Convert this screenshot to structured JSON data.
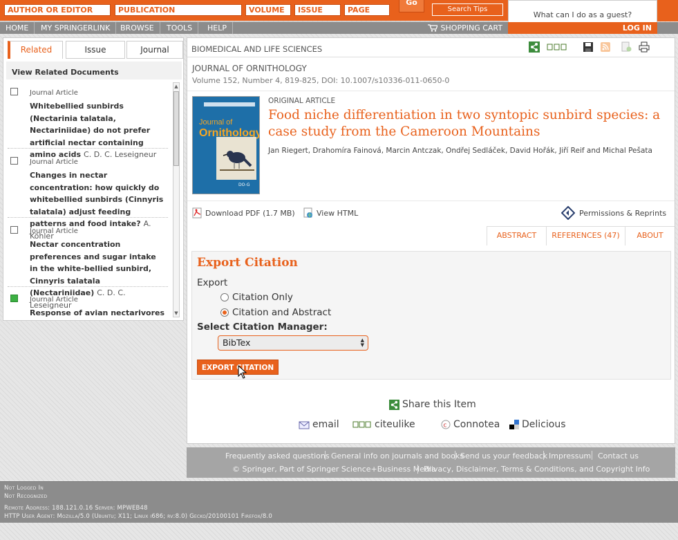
{
  "search": {
    "author_placeholder": "AUTHOR OR EDITOR",
    "publication_placeholder": "PUBLICATION",
    "volume_placeholder": "VOLUME",
    "issue_placeholder": "ISSUE",
    "page_placeholder": "PAGE",
    "go_label": "Go",
    "tips_label": "Search Tips"
  },
  "guest": {
    "prompt": "What can I do as a guest?",
    "login_label": "LOG IN"
  },
  "nav": {
    "items": [
      "HOME",
      "MY SPRINGERLINK",
      "BROWSE",
      "TOOLS",
      "HELP"
    ],
    "cart_label": "SHOPPING CART"
  },
  "sidebar": {
    "tabs": [
      "Related",
      "Issue",
      "Journal"
    ],
    "heading": "View Related Documents",
    "items": [
      {
        "type": "Journal Article",
        "title": "Whitebellied sunbirds (Nectarinia talatala, Nectariniidae) do not prefer artificial nectar containing amino acids",
        "author": "C. D. C. Leseigneur",
        "checked": false
      },
      {
        "type": "Journal Article",
        "title": "Changes in nectar concentration: how quickly do whitebellied sunbirds (Cinnyris talatala) adjust feeding patterns and food intake?",
        "author": "A. Köhler",
        "checked": false
      },
      {
        "type": "Journal Article",
        "title": "Nectar concentration preferences and sugar intake in the white-bellied sunbird, Cinnyris talatala (Nectariniidae)",
        "author": "C. D. C. Leseigneur",
        "checked": false
      },
      {
        "type": "Journal Article",
        "title": "Response of avian nectarivores to the",
        "author": "",
        "checked": true
      }
    ]
  },
  "main": {
    "breadcrumb": "BIOMEDICAL AND LIFE SCIENCES",
    "journal": "JOURNAL OF ORNITHOLOGY",
    "volume_line": "Volume 152, Number 4, 819-825, DOI: 10.1007/s10336-011-0650-0",
    "cover_title_top": "Journal of",
    "cover_title_main": "Ornithology",
    "cover_badge": "DO-G",
    "article_type": "ORIGINAL ARTICLE",
    "article_title": "Food niche differentiation in two syntopic sunbird species: a case study from the Cameroon Mountains",
    "authors": "Jan Riegert, Drahomíra Fainová, Marcin Antczak, Ondřej Sedláček, David Hořák, Jiří Reif and Michal Pešata",
    "download_pdf": "Download PDF (1.7 MB)",
    "view_html": "View HTML",
    "permissions": "Permissions & Reprints",
    "tabs": {
      "abstract": "ABSTRACT",
      "references": "REFERENCES (47)",
      "about": "ABOUT"
    }
  },
  "export_citation": {
    "title": "Export Citation",
    "export_label": "Export",
    "option_citation_only": "Citation Only",
    "option_citation_abstract": "Citation and Abstract",
    "selected_option": "Citation and Abstract",
    "manager_label": "Select Citation Manager:",
    "manager_value": "BibTex",
    "button_label": "EXPORT CITATION"
  },
  "share": {
    "heading": "Share this Item",
    "items": [
      "email",
      "citeulike",
      "Connotea",
      "Delicious"
    ]
  },
  "footer": {
    "links": [
      "Frequently asked questions",
      "General info on journals and books",
      "Send us your feedback",
      "Impressum",
      "Contact us"
    ],
    "copyright_left": "© Springer, Part of Springer Science+Business Media",
    "copyright_right": "Privacy, Disclaimer, Terms & Conditions, and Copyright Info"
  },
  "status": {
    "logged": "Not Logged In",
    "recognized": "Not Recognized",
    "remote_line": "Remote Address: 188.121.0.16   Server: MPWEB48",
    "agent_line": "HTTP User Agent: Mozilla/5.0 (Ubuntu; X11; Linux i686; rv:8.0) Gecko/20100101 Firefox/8.0"
  },
  "colors": {
    "brand_orange": "#e8611c",
    "nav_gray": "#8c8c8c"
  }
}
